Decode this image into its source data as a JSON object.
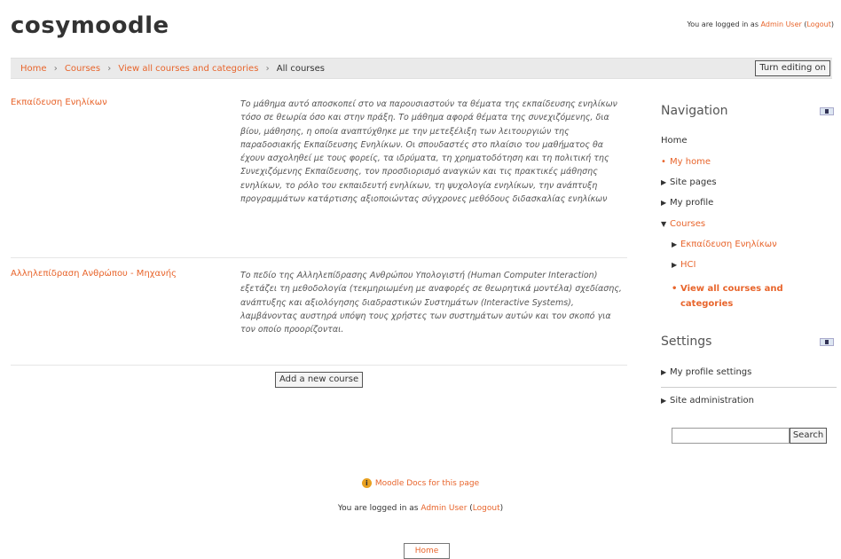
{
  "header": {
    "site_title": "cosymoodle",
    "login_prefix": "You are logged in as ",
    "login_user": "Admin User",
    "login_open": " (",
    "logout": "Logout",
    "login_close": ")"
  },
  "breadcrumb": {
    "items": [
      "Home",
      "Courses",
      "View all courses and categories"
    ],
    "current": "All courses",
    "separator": "›"
  },
  "toolbar": {
    "turn_editing_label": "Turn editing on"
  },
  "courses": [
    {
      "name": "Εκπαίδευση Ενηλίκων",
      "summary": "Το μάθημα αυτό αποσκοπεί στο να παρουσιαστούν τα θέματα της εκπαίδευσης ενηλίκων τόσο σε θεωρία όσο και στην πράξη. Το μάθημα αφορά θέματα της συνεχιζόμενης, δια βίου, μάθησης, η οποία αναπτύχθηκε με την μετεξέλιξη των λειτουργιών της παραδοσιακής Εκπαίδευσης Ενηλίκων. Οι σπουδαστές στο πλαίσιο του μαθήματος θα έχουν ασχοληθεί με τους φορείς, τα ιδρύματα, τη χρηματοδότηση και τη πολιτική της Συνεχιζόμενης Εκπαίδευσης, τον προσδιορισμό αναγκών και τις πρακτικές μάθησης ενηλίκων, το ρόλο του εκπαιδευτή ενηλίκων, τη ψυχολογία ενηλίκων, την ανάπτυξη προγραμμάτων κατάρτισης αξιοποιώντας σύγχρονες μεθόδους διδασκαλίας ενηλίκων"
    },
    {
      "name": "Αλληλεπίδραση Ανθρώπου - Μηχανής",
      "summary": "Το πεδίο της Αλληλεπίδρασης Ανθρώπου Υπολογιστή (Human Computer Interaction) εξετάζει τη μεθοδολογία (τεκμηριωμένη με αναφορές σε θεωρητικά μοντέλα) σχεδίασης, ανάπτυξης και αξιολόγησης διαδραστικών Συστημάτων (Interactive Systems), λαμβάνοντας αυστηρά υπόψη τους χρήστες των συστημάτων αυτών και τον σκοπό για τον οποίο προορίζονται."
    }
  ],
  "add_course_label": "Add a new course",
  "navigation": {
    "title": "Navigation",
    "home": "Home",
    "my_home": "My home",
    "site_pages": "Site pages",
    "my_profile": "My profile",
    "courses": "Courses",
    "course_1": "Εκπαίδευση Ενηλίκων",
    "course_2": "HCI",
    "view_all_line1": "View all courses and",
    "view_all_line2": "categories"
  },
  "settings": {
    "title": "Settings",
    "my_profile_settings": "My profile settings",
    "site_administration": "Site administration"
  },
  "search": {
    "button_label": "Search",
    "value": ""
  },
  "footer": {
    "docs_link": "Moodle Docs for this page",
    "login_prefix": "You are logged in as ",
    "login_user": "Admin User",
    "login_open": " (",
    "logout": "Logout",
    "login_close": ")",
    "home_button": "Home"
  },
  "colors": {
    "link": "#e8652c",
    "navbar_bg": "#eaeaea"
  },
  "icons": [
    "info-icon",
    "block-toggle-icon",
    "triangle-right-icon",
    "triangle-down-icon",
    "bullet-icon"
  ]
}
